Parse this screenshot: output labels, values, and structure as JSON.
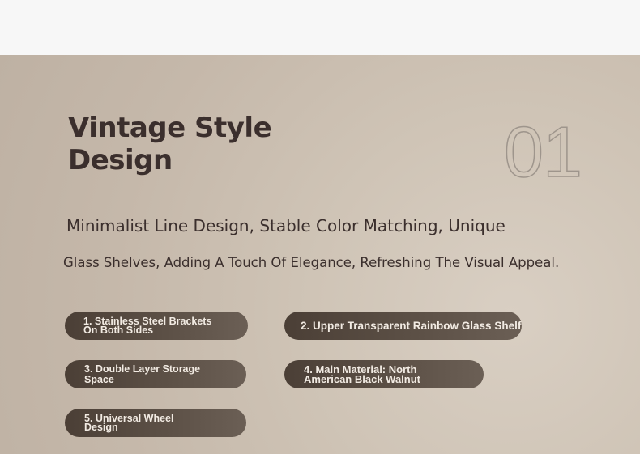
{
  "section": {
    "title": "Vintage Style Design",
    "index": "01",
    "line1": "Minimalist Line Design, Stable Color Matching, Unique",
    "line2": "Glass Shelves, Adding A Touch Of Elegance, Refreshing The Visual Appeal."
  },
  "features": [
    {
      "label": "1. Stainless Steel Brackets On Both Sides"
    },
    {
      "label": "2. Upper Transparent Rainbow Glass Shelf"
    },
    {
      "label": "3. Double Layer Storage Space"
    },
    {
      "label": "4. Main Material: North American Black Walnut"
    },
    {
      "label": "5. Universal Wheel Design"
    }
  ],
  "colors": {
    "heading": "#3b2f2d",
    "pill_bg": "#4b3f36",
    "pill_text": "#f2ebe3",
    "panel_bg": "#c9bdaf"
  }
}
